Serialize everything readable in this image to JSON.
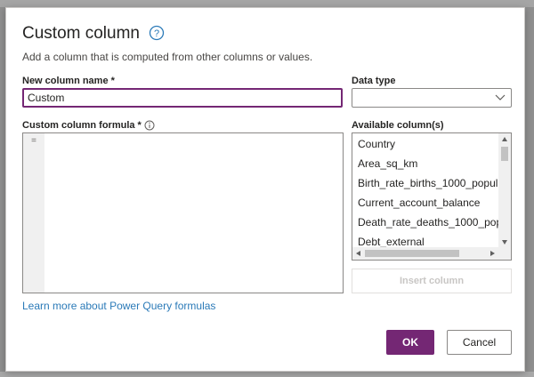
{
  "dialog": {
    "title": "Custom column",
    "subtitle": "Add a column that is computed from other columns or values.",
    "help_icon": "question-circle-icon"
  },
  "name_field": {
    "label": "New column name *",
    "value": "Custom"
  },
  "data_type": {
    "label": "Data type",
    "value": ""
  },
  "formula": {
    "label": "Custom column formula *",
    "info_icon": "info-circle-icon",
    "line_marker": "="
  },
  "available_columns": {
    "label": "Available column(s)",
    "items": [
      "Country",
      "Area_sq_km",
      "Birth_rate_births_1000_populat",
      "Current_account_balance",
      "Death_rate_deaths_1000_popu",
      "Debt_external"
    ]
  },
  "insert_button": "Insert column",
  "learn_link": "Learn more about Power Query formulas",
  "buttons": {
    "ok": "OK",
    "cancel": "Cancel"
  },
  "colors": {
    "accent": "#742774",
    "link": "#2b7ab8"
  }
}
